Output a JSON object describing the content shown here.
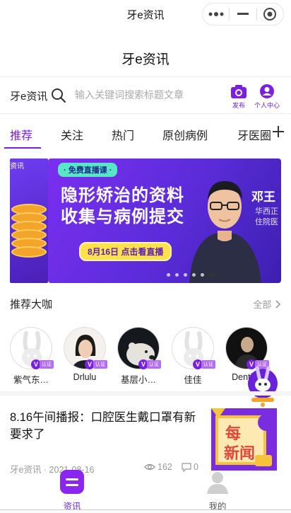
{
  "topbar": {
    "title": "牙e资讯"
  },
  "header": {
    "title": "牙e资讯"
  },
  "search": {
    "brand": "牙e资讯",
    "placeholder": "输入关键词搜索标题文章",
    "publish_label": "发布",
    "profile_label": "个人中心"
  },
  "tabs": [
    "推荐",
    "关注",
    "热门",
    "原创病例",
    "牙医圈"
  ],
  "banner": {
    "badge": "· 免费直播课 ·",
    "headline_line1": "隐形矫治的资料",
    "headline_line2": "收集与病例提交",
    "cta": "8月16日 点击看直播",
    "side_name": "邓王",
    "side_sub_line1": "华西正",
    "side_sub_line2": "住院医",
    "prev_slide_label": "资讯",
    "dot_count": 6,
    "active_dot": 5
  },
  "experts_section": {
    "title": "推荐大咖",
    "all_label": "全部",
    "verified_tag": "认证",
    "items": [
      {
        "name": "紫气东…",
        "avatar": "default-rabbit"
      },
      {
        "name": "Drlulu",
        "avatar": "woman-photo"
      },
      {
        "name": "基层小…",
        "avatar": "bear-photo"
      },
      {
        "name": "佳佳",
        "avatar": "default-rabbit"
      },
      {
        "name": "Denti…",
        "avatar": "man-photo"
      }
    ]
  },
  "article": {
    "title": "8.16午间播报：口腔医生戴口罩有新要求了",
    "source": "牙e资讯 · 2021-08-16",
    "views": "162",
    "comments": "0",
    "thumb_text_1": "每",
    "thumb_text_2": "新闻"
  },
  "bottomnav": {
    "home_label": "资讯",
    "mine_label": "我的"
  },
  "colors": {
    "accent": "#7b1fe0",
    "banner_start": "#7a2ff0",
    "banner_end": "#3d1fb0",
    "cta_bg": "#ffe14d"
  }
}
